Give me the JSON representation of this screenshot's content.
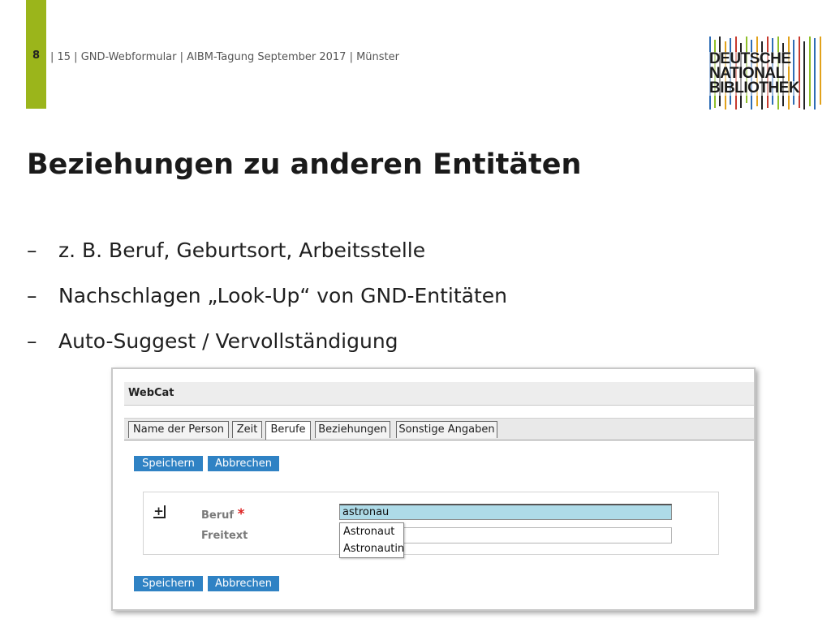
{
  "header": {
    "page_number": "8",
    "text": "| 15 | GND-Webformular | AIBM-Tagung September 2017 | Münster",
    "accent_color": "#9bb51b"
  },
  "logo": {
    "line1": "DEUTSCHE",
    "line2": "NATIONAL",
    "line3": "BIBLIOTHEK"
  },
  "slide": {
    "title": "Beziehungen zu anderen Entitäten",
    "bullets": [
      {
        "dash": "–",
        "text": "z. B. Beruf, Geburtsort, Arbeitsstelle"
      },
      {
        "dash": "–",
        "text": "Nachschlagen „Look-Up“ von GND-Entitäten"
      },
      {
        "dash": "–",
        "text": "Auto-Suggest / Vervollständigung"
      }
    ]
  },
  "webcat": {
    "app_title": "WebCat",
    "tabs": [
      "Name der Person",
      "Zeit",
      "Berufe",
      "Beziehungen",
      "Sonstige Angaben"
    ],
    "active_tab": "Berufe",
    "save_label": "Speichern",
    "cancel_label": "Abbrechen",
    "add_symbol": "+",
    "fields": {
      "beruf_label": "Beruf",
      "required_marker": "*",
      "beruf_value": "astronau",
      "freitext_label": "Freitext",
      "freitext_value": ""
    },
    "suggestions": [
      "Astronaut",
      "Astronautin"
    ],
    "button_color": "#2f82c4",
    "active_field_color": "#aedbe8"
  }
}
